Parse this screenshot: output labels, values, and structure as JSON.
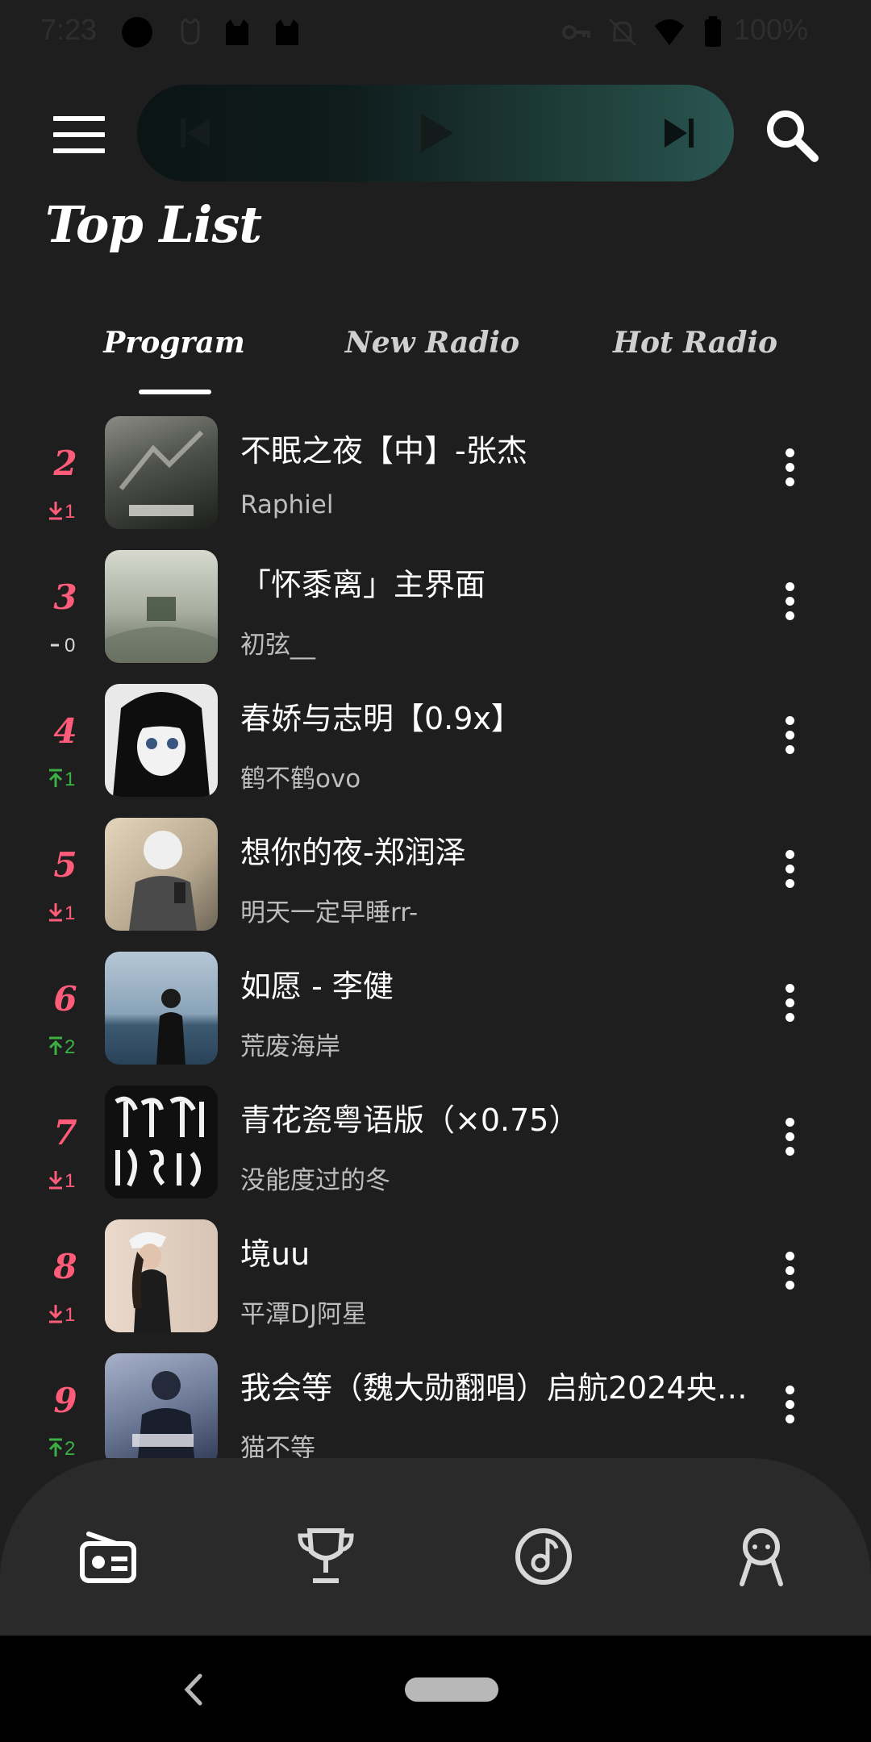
{
  "status_bar": {
    "time": "7:23",
    "battery": "100%",
    "icons": [
      "circle-icon",
      "cat-icon",
      "cat-icon",
      "key-icon",
      "bell-off-icon",
      "wifi-icon",
      "battery-icon"
    ]
  },
  "header": {
    "menu_icon": "hamburger-menu-icon",
    "search_icon": "search-icon",
    "player": {
      "prev_icon": "skip-previous-icon",
      "play_icon": "play-icon",
      "next_icon": "skip-next-icon",
      "gradient_colors": [
        "#0c1414",
        "#2a5550"
      ]
    },
    "title": "Top List"
  },
  "tabs": [
    {
      "label": "Program",
      "active": true
    },
    {
      "label": "New Radio",
      "active": false
    },
    {
      "label": "Hot Radio",
      "active": false
    }
  ],
  "list": [
    {
      "rank": "2",
      "trend": "down",
      "change": "1",
      "title": "不眠之夜【中】-张杰",
      "subtitle": "Raphiel",
      "cover_colors": [
        "#6b6e66",
        "#2b2d2a"
      ]
    },
    {
      "rank": "3",
      "trend": "same",
      "change": "0",
      "title": "「怀黍离」主界面",
      "subtitle": "初弦__",
      "cover_colors": [
        "#c8cbc0",
        "#7a8275"
      ]
    },
    {
      "rank": "4",
      "trend": "up",
      "change": "1",
      "title": "春娇与志明【0.9x】",
      "subtitle": "鹤不鹤ovo",
      "cover_colors": [
        "#e8e8e8",
        "#101010"
      ]
    },
    {
      "rank": "5",
      "trend": "down",
      "change": "1",
      "title": "想你的夜-郑润泽",
      "subtitle": "明天一定早睡rr-",
      "cover_colors": [
        "#d9c9ae",
        "#6f6658"
      ]
    },
    {
      "rank": "6",
      "trend": "up",
      "change": "2",
      "title": "如愿 - 李健",
      "subtitle": "荒废海岸",
      "cover_colors": [
        "#9bb3c6",
        "#2f4a5e"
      ]
    },
    {
      "rank": "7",
      "trend": "down",
      "change": "1",
      "title": "青花瓷粤语版（×0.75）",
      "subtitle": "没能度过的冬",
      "cover_colors": [
        "#111111",
        "#111111"
      ],
      "cover_text": "仰仰\n愜(7)"
    },
    {
      "rank": "8",
      "trend": "down",
      "change": "1",
      "title": "境uu",
      "subtitle": "平潭DJ阿星",
      "cover_colors": [
        "#e8d6c9",
        "#3a2f2c"
      ]
    },
    {
      "rank": "9",
      "trend": "up",
      "change": "2",
      "title": "我会等（魏大勋翻唱）启航2024央…",
      "subtitle": "猫不等",
      "cover_colors": [
        "#8f9ab5",
        "#3b4660"
      ]
    }
  ],
  "more_icon": "more-vertical-icon",
  "bottom_nav": [
    {
      "icon": "radio-icon",
      "active": true
    },
    {
      "icon": "trophy-icon",
      "active": false
    },
    {
      "icon": "music-disc-icon",
      "active": false
    },
    {
      "icon": "profile-icon",
      "active": false
    }
  ],
  "colors": {
    "background": "#1e1e1e",
    "rank": "#ff5c79",
    "trend_up": "#3cb043",
    "trend_down": "#ff5c79",
    "bottom_nav_bg": "#2a2a2a"
  }
}
